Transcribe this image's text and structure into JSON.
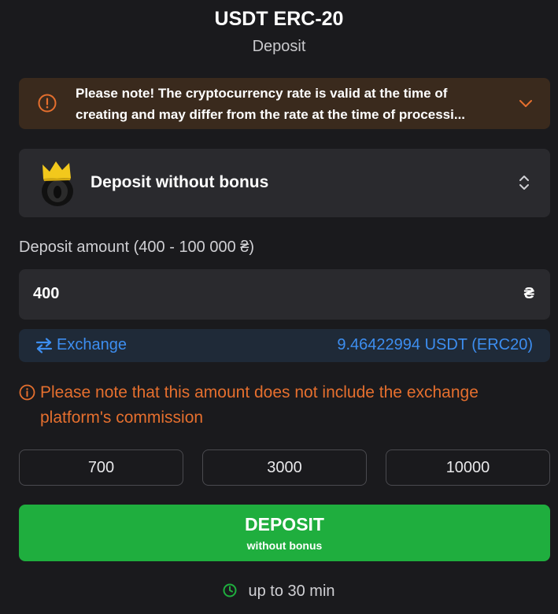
{
  "header": {
    "title": "USDT ERC-20",
    "subtitle": "Deposit"
  },
  "notice": {
    "text_line1": "Please note! The cryptocurrency rate is valid at the time of",
    "text_line2": "creating and may differ from the rate at the time of processi...",
    "icon": "warning-circle-icon",
    "expand_icon": "chevron-down-icon",
    "background_color": "#3a2a1d",
    "accent_color": "#e56f2e"
  },
  "bonus": {
    "selected_label": "Deposit without bonus",
    "logo_icon": "crown-logo-icon",
    "toggle_icon": "chevron-up-down-icon"
  },
  "amount": {
    "label": "Deposit amount (400 - 100 000 ₴)",
    "value": "400",
    "currency_symbol": "₴"
  },
  "exchange": {
    "label": "Exchange",
    "icon": "swap-arrows-icon",
    "value": "9.46422994 USDT (ERC20)",
    "color": "#3d8ef0"
  },
  "commission": {
    "text": "Please note that this amount does not include the exchange platform's commission",
    "icon": "info-circle-icon",
    "color": "#e56f2e"
  },
  "presets": [
    {
      "label": "700"
    },
    {
      "label": "3000"
    },
    {
      "label": "10000"
    }
  ],
  "submit": {
    "label": "DEPOSIT",
    "sublabel": "without bonus",
    "color": "#1fae3e"
  },
  "timing": {
    "text": "up to 30 min",
    "icon": "clock-icon",
    "icon_color": "#1fae3e"
  }
}
